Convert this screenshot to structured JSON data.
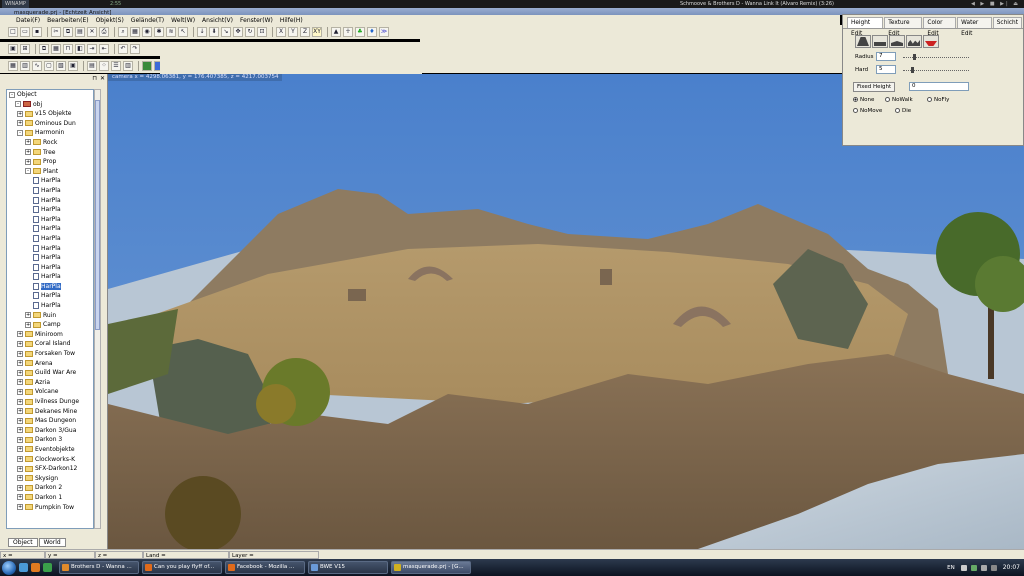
{
  "winamp": {
    "logo": "WINAMP",
    "time": "2:55",
    "track": "Schmoove & Brothers D - Wanna Link It (Alvaro Remix) (3:26)",
    "controls": "◀ ▶ ■ ▶| ⏏"
  },
  "window": {
    "title": "masquerade.prj - [Echtzeit Ansicht]"
  },
  "menu": [
    "Datei(F)",
    "Bearbeiten(E)",
    "Objekt(S)",
    "Gelände(T)",
    "Welt(W)",
    "Ansicht(V)",
    "Fenster(W)",
    "Hilfe(H)"
  ],
  "toolbar1": {
    "axis_x": "X",
    "axis_y": "Y",
    "axis_z": "Z",
    "axis_xy": "XY"
  },
  "toolbar3": {
    "label_t": "T",
    "label_f": "F"
  },
  "coords": "camera x = 4298.06381, y = 176.407385, z = 4217.003754",
  "tree": {
    "root": "Object",
    "obj": "obj",
    "items": [
      {
        "label": "v15 Objekte",
        "depth": 2,
        "kind": "folder",
        "exp": "+"
      },
      {
        "label": "Ominous Dun",
        "depth": 2,
        "kind": "folder",
        "exp": "+"
      },
      {
        "label": "Harmonin",
        "depth": 2,
        "kind": "folder",
        "exp": "-"
      },
      {
        "label": "Rock",
        "depth": 3,
        "kind": "folder",
        "exp": "+"
      },
      {
        "label": "Tree",
        "depth": 3,
        "kind": "folder",
        "exp": "+"
      },
      {
        "label": "Prop",
        "depth": 3,
        "kind": "folder",
        "exp": "+"
      },
      {
        "label": "Plant",
        "depth": 3,
        "kind": "folder",
        "exp": "-"
      },
      {
        "label": "HarPla",
        "depth": 4,
        "kind": "doc"
      },
      {
        "label": "HarPla",
        "depth": 4,
        "kind": "doc"
      },
      {
        "label": "HarPla",
        "depth": 4,
        "kind": "doc"
      },
      {
        "label": "HarPla",
        "depth": 4,
        "kind": "doc"
      },
      {
        "label": "HarPla",
        "depth": 4,
        "kind": "doc"
      },
      {
        "label": "HarPla",
        "depth": 4,
        "kind": "doc"
      },
      {
        "label": "HarPla",
        "depth": 4,
        "kind": "doc"
      },
      {
        "label": "HarPla",
        "depth": 4,
        "kind": "doc"
      },
      {
        "label": "HarPla",
        "depth": 4,
        "kind": "doc"
      },
      {
        "label": "HarPla",
        "depth": 4,
        "kind": "doc"
      },
      {
        "label": "HarPla",
        "depth": 4,
        "kind": "doc"
      },
      {
        "label": "HarPla",
        "depth": 4,
        "kind": "doc",
        "selected": true
      },
      {
        "label": "HarPla",
        "depth": 4,
        "kind": "doc"
      },
      {
        "label": "HarPla",
        "depth": 4,
        "kind": "doc"
      },
      {
        "label": "Ruin",
        "depth": 3,
        "kind": "folder",
        "exp": "+"
      },
      {
        "label": "Camp",
        "depth": 3,
        "kind": "folder",
        "exp": "+"
      },
      {
        "label": "Miniroom",
        "depth": 2,
        "kind": "folder",
        "exp": "+"
      },
      {
        "label": "Coral Island",
        "depth": 2,
        "kind": "folder",
        "exp": "+"
      },
      {
        "label": "Forsaken Tow",
        "depth": 2,
        "kind": "folder",
        "exp": "+"
      },
      {
        "label": "Arena",
        "depth": 2,
        "kind": "folder",
        "exp": "+"
      },
      {
        "label": "Guild War Are",
        "depth": 2,
        "kind": "folder",
        "exp": "+"
      },
      {
        "label": "Azria",
        "depth": 2,
        "kind": "folder",
        "exp": "+"
      },
      {
        "label": "Volcane",
        "depth": 2,
        "kind": "folder",
        "exp": "+"
      },
      {
        "label": "Ivilness Dunge",
        "depth": 2,
        "kind": "folder",
        "exp": "+"
      },
      {
        "label": "Dekanes Mine",
        "depth": 2,
        "kind": "folder",
        "exp": "+"
      },
      {
        "label": "Mas Dungeon",
        "depth": 2,
        "kind": "folder",
        "exp": "+"
      },
      {
        "label": "Darkon 3/Gua",
        "depth": 2,
        "kind": "folder",
        "exp": "+"
      },
      {
        "label": "Darkon 3",
        "depth": 2,
        "kind": "folder",
        "exp": "+"
      },
      {
        "label": "Eventobjekte",
        "depth": 2,
        "kind": "folder",
        "exp": "+"
      },
      {
        "label": "Clockworks-K",
        "depth": 2,
        "kind": "folder",
        "exp": "+"
      },
      {
        "label": "SFX-Darkon12",
        "depth": 2,
        "kind": "folder",
        "exp": "+"
      },
      {
        "label": "Skysign",
        "depth": 2,
        "kind": "folder",
        "exp": "+"
      },
      {
        "label": "Darkon 2",
        "depth": 2,
        "kind": "folder",
        "exp": "+"
      },
      {
        "label": "Darkon 1",
        "depth": 2,
        "kind": "folder",
        "exp": "+"
      },
      {
        "label": "Pumpkin Tow",
        "depth": 2,
        "kind": "folder",
        "exp": "+"
      }
    ]
  },
  "left_tabs": [
    "Object",
    "World"
  ],
  "right_panel": {
    "tabs": [
      "Height Edit",
      "Texture Edit",
      "Color Edit",
      "Water Edit",
      "Schicht"
    ],
    "radius_label": "Radius",
    "radius_value": "7",
    "hard_label": "Hard",
    "hard_value": "5",
    "fixed_height_label": "Fixed Height",
    "fixed_height_value": "0",
    "radios": [
      {
        "label": "None",
        "checked": true
      },
      {
        "label": "NoWalk",
        "checked": false
      },
      {
        "label": "NoFly",
        "checked": false
      },
      {
        "label": "NoMove",
        "checked": false
      },
      {
        "label": "Die",
        "checked": false
      }
    ]
  },
  "statusbar": {
    "x": "x =",
    "y": "y =",
    "z": "z =",
    "land": "Land =",
    "layer": "Layer ="
  },
  "taskbar": {
    "tasks": [
      {
        "label": "Brothers D - Wanna ...",
        "color": "#e08a2a"
      },
      {
        "label": "Can you play flyff of...",
        "color": "#e06a1a"
      },
      {
        "label": "Facebook - Mozilla ...",
        "color": "#e06a1a"
      },
      {
        "label": "BWE V15",
        "color": "#6a9ad8"
      },
      {
        "label": "masquerade.prj - [G...",
        "color": "#d0b020",
        "active": true
      }
    ],
    "lang": "EN",
    "clock": "20:07"
  }
}
